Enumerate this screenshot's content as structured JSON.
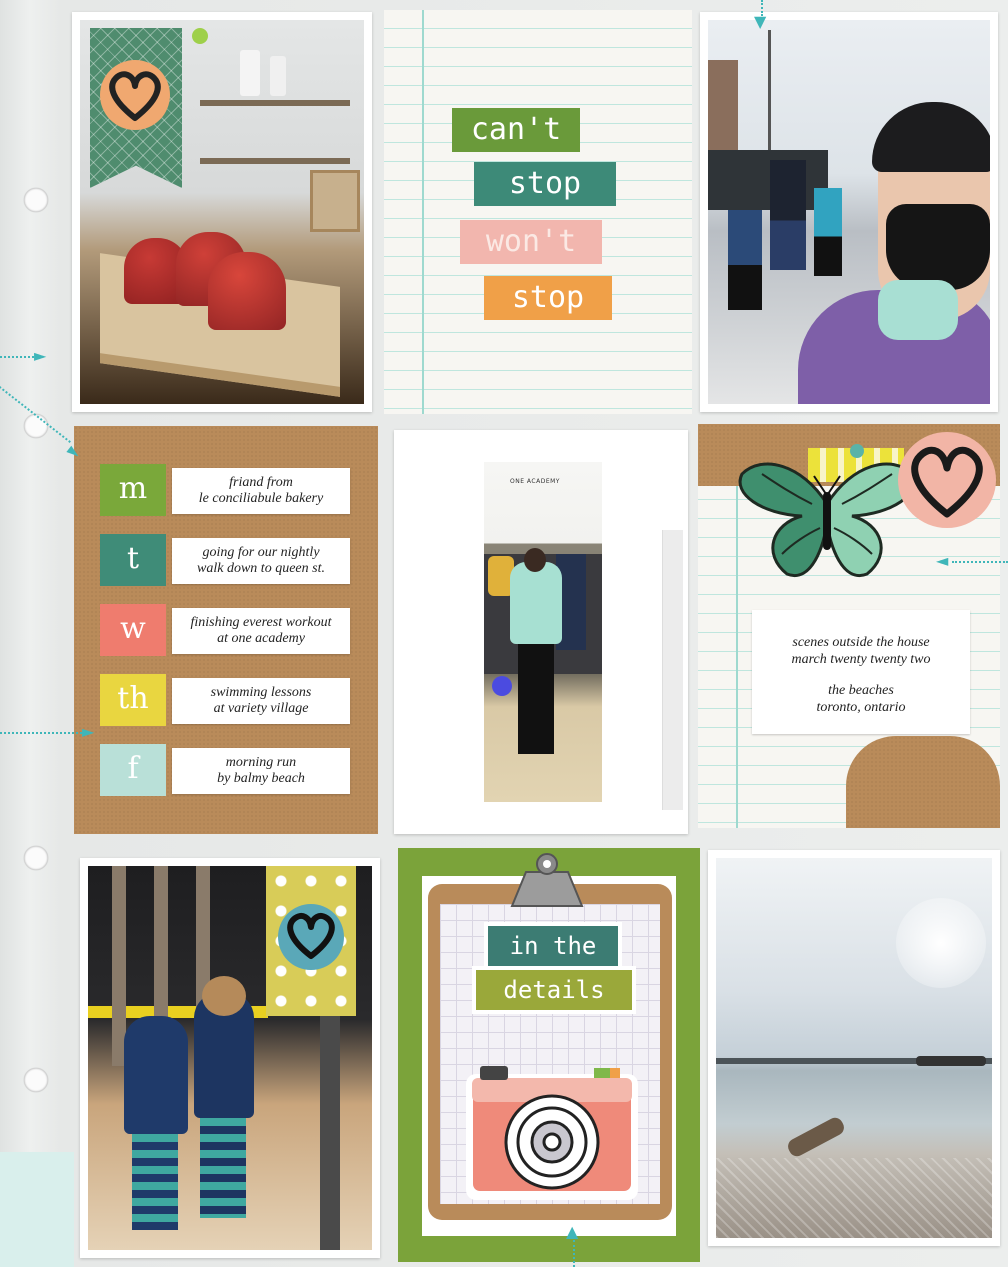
{
  "title_card": {
    "words": [
      "can't",
      "stop",
      "won't",
      "stop"
    ],
    "colors": [
      "#6a9a3a",
      "#3d8a78",
      "#f2b6ae",
      "#f0a048"
    ]
  },
  "days_card": {
    "days": [
      {
        "letter": "m",
        "color": "#7aa83a",
        "note_line1": "friand from",
        "note_line2": "le conciliabule bakery"
      },
      {
        "letter": "t",
        "color": "#3f8c78",
        "note_line1": "going for our nightly",
        "note_line2": "walk down to queen st."
      },
      {
        "letter": "w",
        "color": "#ef7c6e",
        "note_line1": "finishing everest workout",
        "note_line2": "at one academy"
      },
      {
        "letter": "th",
        "color": "#e9d640",
        "note_line1": "swimming lessons",
        "note_line2": "at variety village"
      },
      {
        "letter": "f",
        "color": "#b9e0d8",
        "note_line1": "morning run",
        "note_line2": "by balmy beach"
      }
    ]
  },
  "gym_photo": {
    "sign_text": "ONE ACADEMY"
  },
  "butterfly_card": {
    "line1": "scenes outside the house",
    "line2": "march twenty twenty two",
    "line3": "the beaches",
    "line4": "toronto, ontario"
  },
  "details_card": {
    "word1": "in the",
    "word2": "details",
    "word1_color": "#3c7c73",
    "word2_color": "#9aa83a"
  },
  "icons": [
    "heart-icon",
    "butterfly-icon",
    "camera-icon",
    "clipboard-clip-icon"
  ]
}
